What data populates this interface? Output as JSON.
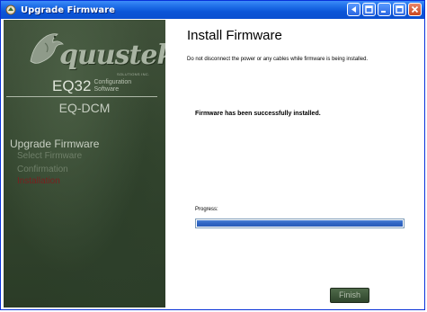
{
  "window": {
    "title": "Upgrade Firmware",
    "icon": "firmware-app-icon",
    "controls": [
      "help-icon",
      "restore-icon",
      "minimize-icon",
      "maximize-icon",
      "close-icon"
    ],
    "colors": {
      "titlebar": "#0b55d8",
      "close_button": "#c9471e"
    }
  },
  "sidebar": {
    "brand": "quustek",
    "brand_sub": "SOLUTIONS INC.",
    "logo_icon": "dragon-icon",
    "product_name": "EQ32",
    "product_sub_line1": "Configuration",
    "product_sub_line2": "Software",
    "device": "EQ-DCM",
    "nav_heading": "Upgrade Firmware",
    "nav_items": [
      {
        "label": "Select Firmware",
        "state": "done"
      },
      {
        "label": "Confirmation",
        "state": "done"
      },
      {
        "label": "Installation",
        "state": "current"
      }
    ],
    "colors": {
      "background": "#34462f",
      "current_item": "#7a1f1f"
    }
  },
  "main": {
    "heading": "Install Firmware",
    "warning": "Do not disconnect the power or any cables while firmware is being installed.",
    "status": "Firmware has been successfully installed.",
    "progress_label": "Progress:",
    "progress_value": 1.0,
    "finish_label": "Finish",
    "colors": {
      "progress_fill": "#2f64c4"
    }
  }
}
